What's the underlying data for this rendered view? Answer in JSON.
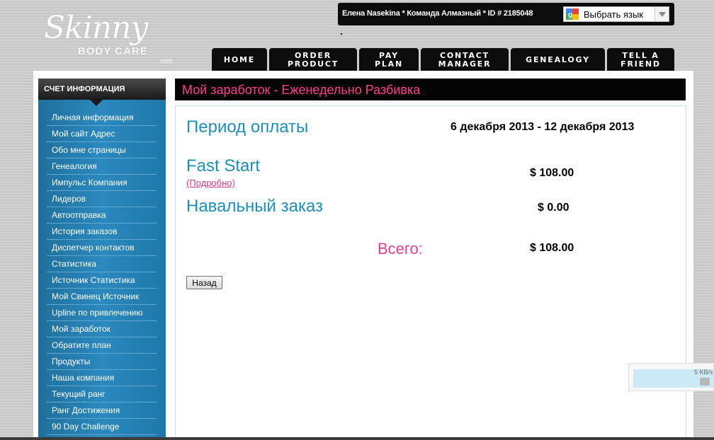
{
  "brand": {
    "script": "Skinny",
    "body": "BODY CARE",
    "dotcom": ".com"
  },
  "userbar": {
    "user_text": "Елена Nasekina * Команда Алмазный * ID # 2185048",
    "translate_label": "Выбрать язык"
  },
  "nav": {
    "tabs": [
      {
        "label": "HOME"
      },
      {
        "label": "ORDER\nPRODUCT"
      },
      {
        "label": "PAY\nPLAN"
      },
      {
        "label": "CONTACT\nMANAGER"
      },
      {
        "label": "GENEALOGY"
      },
      {
        "label": "TELL A\nFRIEND"
      }
    ]
  },
  "sidebar": {
    "title": "СЧЕТ ИНФОРМАЦИЯ",
    "items": [
      {
        "label": "Личная информация"
      },
      {
        "label": "Мой сайт Адрес"
      },
      {
        "label": "Обо мне страницы"
      },
      {
        "label": "Генеалогия"
      },
      {
        "label": "Импульс Компания"
      },
      {
        "label": "Лидеров"
      },
      {
        "label": "Автоотправка"
      },
      {
        "label": "История заказов"
      },
      {
        "label": "Диспетчер контактов"
      },
      {
        "label": "Статистика"
      },
      {
        "label": "Источник Статистика"
      },
      {
        "label": "Мой Свинец Источник"
      },
      {
        "label": "Upline по привлечению"
      },
      {
        "label": "Мой заработок"
      },
      {
        "label": "Обратите план"
      },
      {
        "label": "Продукты"
      },
      {
        "label": "Наша компания"
      },
      {
        "label": "Текущий ранг"
      },
      {
        "label": "Ранг Достижения"
      },
      {
        "label": "90 Day Challenge"
      }
    ]
  },
  "main": {
    "header": "Мой заработок - Еженедельно Разбивка",
    "period_label": "Период оплаты",
    "period_value": "6 декабря 2013 - 12 декабря 2013",
    "fast_start_label": "Fast Start",
    "fast_start_detail": "(Подробно)",
    "fast_start_value": "$ 108.00",
    "bulk_order_label": "Навальный заказ",
    "bulk_order_value": "$ 0.00",
    "total_label": "Всего:",
    "total_value": "$ 108.00",
    "back_button": "Назад"
  },
  "widget": {
    "speed": "5 KB/s"
  }
}
